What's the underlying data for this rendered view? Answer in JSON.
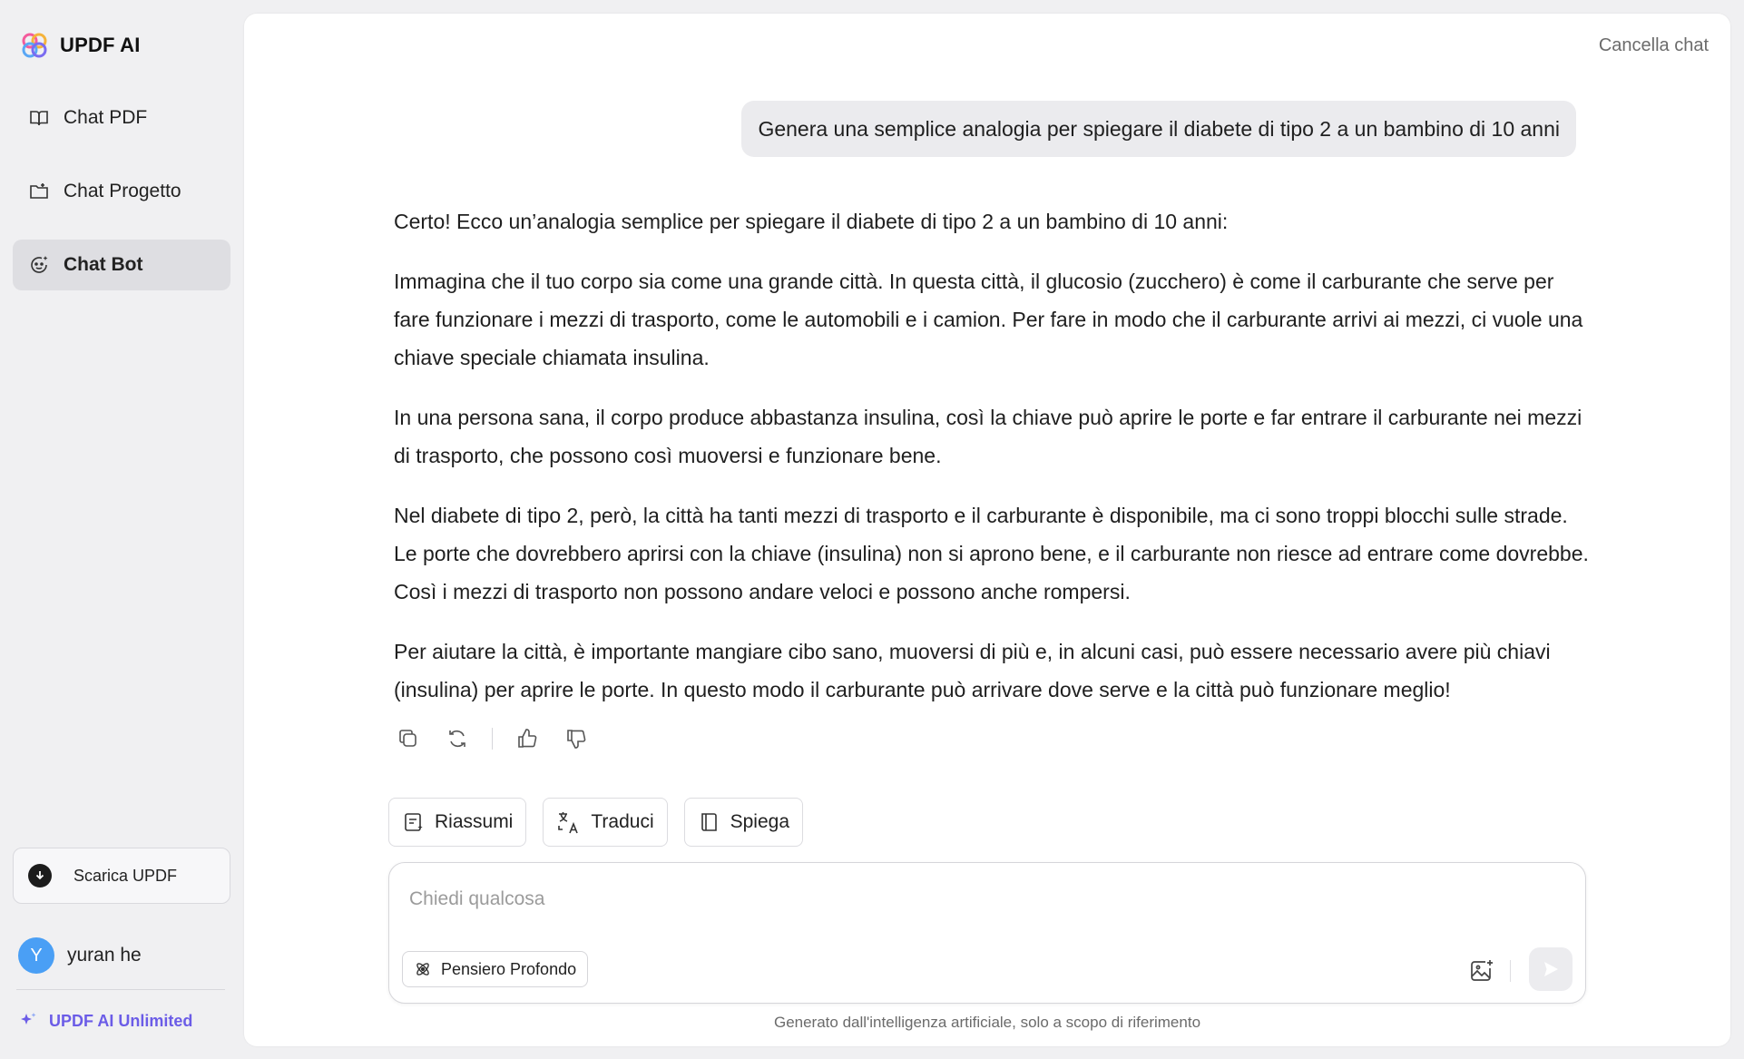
{
  "app": {
    "name": "UPDF AI"
  },
  "sidebar": {
    "items": [
      {
        "label": "Chat PDF",
        "icon": "book-open-icon",
        "active": false
      },
      {
        "label": "Chat Progetto",
        "icon": "folder-icon",
        "active": false
      },
      {
        "label": "Chat Bot",
        "icon": "bot-face-icon",
        "active": true
      }
    ],
    "download_label": "Scarica UPDF",
    "user": {
      "initial": "Y",
      "name": "yuran he"
    },
    "unlimited_label": "UPDF AI Unlimited"
  },
  "header": {
    "clear_chat_label": "Cancella chat"
  },
  "conversation": {
    "user_message": "Genera una semplice analogia per spiegare il diabete di tipo 2 a un bambino di 10 anni",
    "assistant_paragraphs": [
      "Certo! Ecco un’analogia semplice per spiegare il diabete di tipo 2 a un bambino di 10 anni:",
      "Immagina che il tuo corpo sia come una grande città. In questa città, il glucosio (zucchero) è come il carburante che serve per fare funzionare i mezzi di trasporto, come le automobili e i camion. Per fare in modo che il carburante arrivi ai mezzi, ci vuole una chiave speciale chiamata insulina.",
      "In una persona sana, il corpo produce abbastanza insulina, così la chiave può aprire le porte e far entrare il carburante nei mezzi di trasporto, che possono così muoversi e funzionare bene.",
      "Nel diabete di tipo 2, però, la città ha tanti mezzi di trasporto e il carburante è disponibile, ma ci sono troppi blocchi sulle strade. Le porte che dovrebbero aprirsi con la chiave (insulina) non si aprono bene, e il carburante non riesce ad entrare come dovrebbe. Così i mezzi di trasporto non possono andare veloci e possono anche rompersi.",
      "Per aiutare la città, è importante mangiare cibo sano, muoversi di più e, in alcuni casi, può essere necessario avere più chiavi (insulina) per aprire le porte. In questo modo il carburante può arrivare dove serve e la città può funzionare meglio!"
    ]
  },
  "quick_actions": [
    {
      "label": "Riassumi",
      "icon": "summarize-icon"
    },
    {
      "label": "Traduci",
      "icon": "translate-icon"
    },
    {
      "label": "Spiega",
      "icon": "book-icon"
    }
  ],
  "composer": {
    "placeholder": "Chiedi qualcosa",
    "value": "",
    "deep_thinking_label": "Pensiero Profondo"
  },
  "footer": {
    "disclaimer": "Generato dall'intelligenza artificiale, solo a scopo di riferimento"
  },
  "colors": {
    "accent": "#6b5ce7",
    "avatar": "#4a9ff5",
    "active_nav": "#dedee2",
    "user_bubble": "#ebebee"
  }
}
